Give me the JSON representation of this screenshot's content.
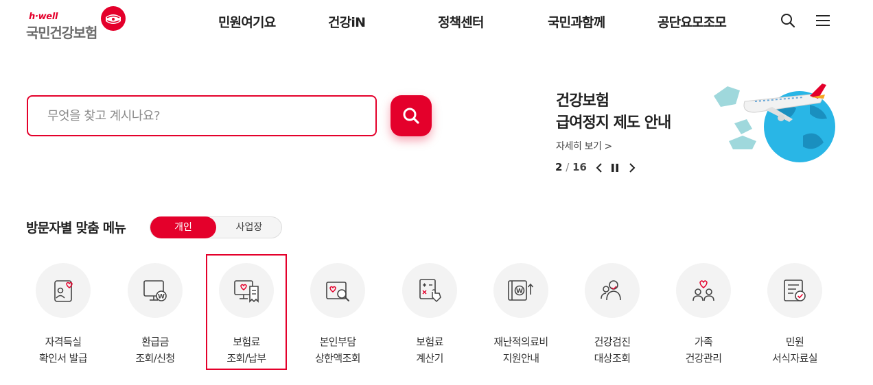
{
  "brand": {
    "sub": "h·well",
    "name": "국민건강보험",
    "accent": "#e4002b"
  },
  "gnb": [
    "민원여기요",
    "건강iN",
    "정책센터",
    "국민과함께",
    "공단요모조모"
  ],
  "header_icons": [
    "search-icon",
    "hamburger-menu-icon"
  ],
  "search": {
    "placeholder": "무엇을 찾고 계시나요?",
    "value": ""
  },
  "banner": {
    "title_line1": "건강보험",
    "title_line2": "급여정지 제도 안내",
    "link": "자세히 보기 >",
    "page_current": "2",
    "page_sep": "/",
    "page_total": "16"
  },
  "menu": {
    "title": "방문자별 맞춤 메뉴",
    "toggle_on": "개인",
    "toggle_off": "사업장",
    "items": [
      {
        "l1": "자격득실",
        "l2": "확인서 발급",
        "icon": "certificate-user-icon"
      },
      {
        "l1": "환급금",
        "l2": "조회/신청",
        "icon": "monitor-won-icon"
      },
      {
        "l1": "보험료",
        "l2": "조회/납부",
        "icon": "monitor-receipt-icon"
      },
      {
        "l1": "본인부담",
        "l2": "상한액조회",
        "icon": "card-search-icon"
      },
      {
        "l1": "보험료",
        "l2": "계산기",
        "icon": "calculator-hand-icon"
      },
      {
        "l1": "재난적의료비",
        "l2": "지원안내",
        "icon": "book-won-icon"
      },
      {
        "l1": "건강검진",
        "l2": "대상조회",
        "icon": "people-search-icon"
      },
      {
        "l1": "가족",
        "l2": "건강관리",
        "icon": "family-heart-icon"
      },
      {
        "l1": "민원",
        "l2": "서식자료실",
        "icon": "document-check-icon"
      }
    ]
  }
}
